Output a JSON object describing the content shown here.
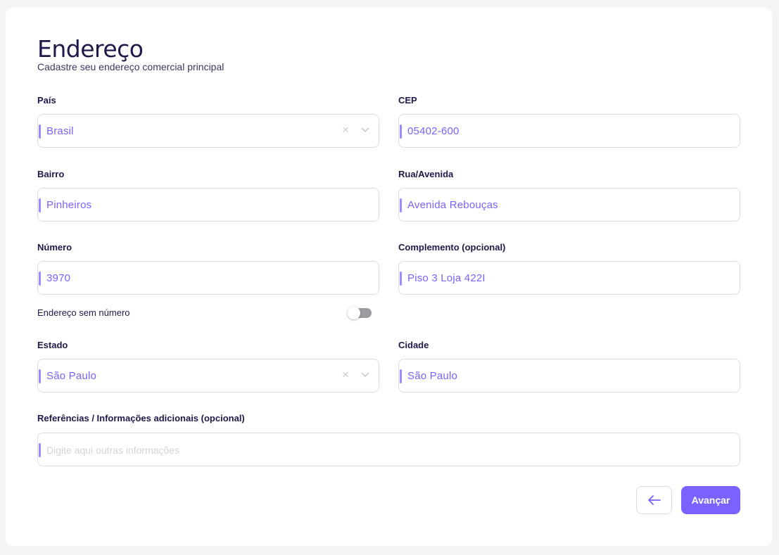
{
  "header": {
    "title": "Endereço",
    "subtitle": "Cadastre seu endereço comercial principal"
  },
  "fields": {
    "pais": {
      "label": "País",
      "value": "Brasil"
    },
    "cep": {
      "label": "CEP",
      "value": "05402-600"
    },
    "bairro": {
      "label": "Bairro",
      "value": "Pinheiros"
    },
    "rua": {
      "label": "Rua/Avenida",
      "value": "Avenida Rebouças"
    },
    "numero": {
      "label": "Número",
      "value": "3970"
    },
    "complemento": {
      "label": "Complemento (opcional)",
      "value": "Piso 3 Loja 422I"
    },
    "estado": {
      "label": "Estado",
      "value": "São Paulo"
    },
    "cidade": {
      "label": "Cidade",
      "value": "São Paulo"
    },
    "referencias": {
      "label": "Referências / Informações adicionais (opcional)",
      "placeholder": "Digite aqui outras informações"
    }
  },
  "toggle": {
    "label": "Endereço sem número",
    "on": false
  },
  "actions": {
    "back_icon": "arrow-left-icon",
    "next_label": "Avançar"
  },
  "colors": {
    "accent": "#7b61ff",
    "text": "#1d1a4a",
    "border": "#dcdce4"
  },
  "icons": {
    "clear": "×",
    "dropdown": "chevron-down-icon"
  }
}
